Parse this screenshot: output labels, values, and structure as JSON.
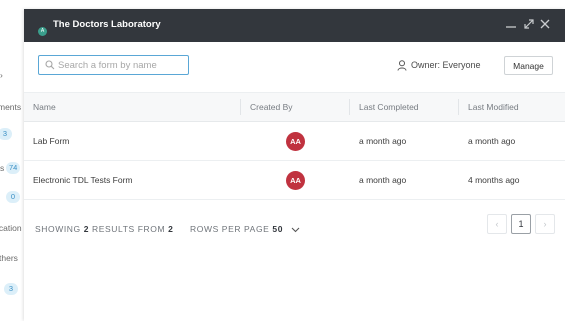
{
  "background_sidebar": {
    "items": [
      {
        "label": "ments"
      },
      {
        "label": "s"
      },
      {
        "label": "ication"
      },
      {
        "label": "thers"
      }
    ],
    "badges": [
      "3",
      "74",
      "0",
      "3"
    ]
  },
  "modal": {
    "logo_letter": "A",
    "title": "The Doctors Laboratory",
    "controls": {
      "minimize": "—",
      "expand": "⤢",
      "close": "✕"
    }
  },
  "toolbar": {
    "search_placeholder": "Search a form by name",
    "search_value": "",
    "owner_label": "Owner: Everyone",
    "manage_label": "Manage"
  },
  "table": {
    "columns": [
      "Name",
      "Created By",
      "Last Completed",
      "Last Modified"
    ],
    "rows": [
      {
        "name": "Lab Form",
        "created_by": "AA",
        "last_completed": "a month ago",
        "last_modified": "a month ago"
      },
      {
        "name": "Electronic TDL Tests Form",
        "created_by": "AA",
        "last_completed": "a month ago",
        "last_modified": "4 months ago"
      }
    ]
  },
  "footer": {
    "showing_prefix": "SHOWING",
    "showing_count": "2",
    "results_from": "RESULTS FROM",
    "total": "2",
    "rows_per_page_label": "ROWS PER PAGE",
    "rows_per_page_value": "50",
    "current_page": "1",
    "prev": "‹",
    "next": "›"
  },
  "colors": {
    "header_bg": "#33373d",
    "avatar_bg": "#c0323f",
    "focus_border": "#5aa7d6",
    "badge_bg": "#dceff9"
  }
}
